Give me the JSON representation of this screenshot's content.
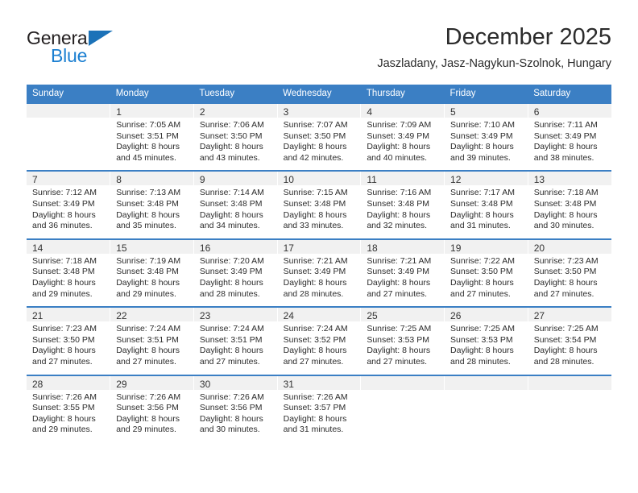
{
  "brand": {
    "name_top": "General",
    "name_bottom": "Blue",
    "triangle_color": "#1b72b8",
    "blue_color": "#1b7fd1"
  },
  "header": {
    "title": "December 2025",
    "subtitle": "Jaszladany, Jasz-Nagykun-Szolnok, Hungary"
  },
  "theme": {
    "header_bg": "#3b7fc4",
    "daynum_bg": "#f1f1f1",
    "text": "#2b2b2b"
  },
  "weekdays": [
    "Sunday",
    "Monday",
    "Tuesday",
    "Wednesday",
    "Thursday",
    "Friday",
    "Saturday"
  ],
  "weeks": [
    [
      {
        "day": "",
        "sunrise": "",
        "sunset": "",
        "daylight1": "",
        "daylight2": ""
      },
      {
        "day": "1",
        "sunrise": "Sunrise: 7:05 AM",
        "sunset": "Sunset: 3:51 PM",
        "daylight1": "Daylight: 8 hours",
        "daylight2": "and 45 minutes."
      },
      {
        "day": "2",
        "sunrise": "Sunrise: 7:06 AM",
        "sunset": "Sunset: 3:50 PM",
        "daylight1": "Daylight: 8 hours",
        "daylight2": "and 43 minutes."
      },
      {
        "day": "3",
        "sunrise": "Sunrise: 7:07 AM",
        "sunset": "Sunset: 3:50 PM",
        "daylight1": "Daylight: 8 hours",
        "daylight2": "and 42 minutes."
      },
      {
        "day": "4",
        "sunrise": "Sunrise: 7:09 AM",
        "sunset": "Sunset: 3:49 PM",
        "daylight1": "Daylight: 8 hours",
        "daylight2": "and 40 minutes."
      },
      {
        "day": "5",
        "sunrise": "Sunrise: 7:10 AM",
        "sunset": "Sunset: 3:49 PM",
        "daylight1": "Daylight: 8 hours",
        "daylight2": "and 39 minutes."
      },
      {
        "day": "6",
        "sunrise": "Sunrise: 7:11 AM",
        "sunset": "Sunset: 3:49 PM",
        "daylight1": "Daylight: 8 hours",
        "daylight2": "and 38 minutes."
      }
    ],
    [
      {
        "day": "7",
        "sunrise": "Sunrise: 7:12 AM",
        "sunset": "Sunset: 3:49 PM",
        "daylight1": "Daylight: 8 hours",
        "daylight2": "and 36 minutes."
      },
      {
        "day": "8",
        "sunrise": "Sunrise: 7:13 AM",
        "sunset": "Sunset: 3:48 PM",
        "daylight1": "Daylight: 8 hours",
        "daylight2": "and 35 minutes."
      },
      {
        "day": "9",
        "sunrise": "Sunrise: 7:14 AM",
        "sunset": "Sunset: 3:48 PM",
        "daylight1": "Daylight: 8 hours",
        "daylight2": "and 34 minutes."
      },
      {
        "day": "10",
        "sunrise": "Sunrise: 7:15 AM",
        "sunset": "Sunset: 3:48 PM",
        "daylight1": "Daylight: 8 hours",
        "daylight2": "and 33 minutes."
      },
      {
        "day": "11",
        "sunrise": "Sunrise: 7:16 AM",
        "sunset": "Sunset: 3:48 PM",
        "daylight1": "Daylight: 8 hours",
        "daylight2": "and 32 minutes."
      },
      {
        "day": "12",
        "sunrise": "Sunrise: 7:17 AM",
        "sunset": "Sunset: 3:48 PM",
        "daylight1": "Daylight: 8 hours",
        "daylight2": "and 31 minutes."
      },
      {
        "day": "13",
        "sunrise": "Sunrise: 7:18 AM",
        "sunset": "Sunset: 3:48 PM",
        "daylight1": "Daylight: 8 hours",
        "daylight2": "and 30 minutes."
      }
    ],
    [
      {
        "day": "14",
        "sunrise": "Sunrise: 7:18 AM",
        "sunset": "Sunset: 3:48 PM",
        "daylight1": "Daylight: 8 hours",
        "daylight2": "and 29 minutes."
      },
      {
        "day": "15",
        "sunrise": "Sunrise: 7:19 AM",
        "sunset": "Sunset: 3:48 PM",
        "daylight1": "Daylight: 8 hours",
        "daylight2": "and 29 minutes."
      },
      {
        "day": "16",
        "sunrise": "Sunrise: 7:20 AM",
        "sunset": "Sunset: 3:49 PM",
        "daylight1": "Daylight: 8 hours",
        "daylight2": "and 28 minutes."
      },
      {
        "day": "17",
        "sunrise": "Sunrise: 7:21 AM",
        "sunset": "Sunset: 3:49 PM",
        "daylight1": "Daylight: 8 hours",
        "daylight2": "and 28 minutes."
      },
      {
        "day": "18",
        "sunrise": "Sunrise: 7:21 AM",
        "sunset": "Sunset: 3:49 PM",
        "daylight1": "Daylight: 8 hours",
        "daylight2": "and 27 minutes."
      },
      {
        "day": "19",
        "sunrise": "Sunrise: 7:22 AM",
        "sunset": "Sunset: 3:50 PM",
        "daylight1": "Daylight: 8 hours",
        "daylight2": "and 27 minutes."
      },
      {
        "day": "20",
        "sunrise": "Sunrise: 7:23 AM",
        "sunset": "Sunset: 3:50 PM",
        "daylight1": "Daylight: 8 hours",
        "daylight2": "and 27 minutes."
      }
    ],
    [
      {
        "day": "21",
        "sunrise": "Sunrise: 7:23 AM",
        "sunset": "Sunset: 3:50 PM",
        "daylight1": "Daylight: 8 hours",
        "daylight2": "and 27 minutes."
      },
      {
        "day": "22",
        "sunrise": "Sunrise: 7:24 AM",
        "sunset": "Sunset: 3:51 PM",
        "daylight1": "Daylight: 8 hours",
        "daylight2": "and 27 minutes."
      },
      {
        "day": "23",
        "sunrise": "Sunrise: 7:24 AM",
        "sunset": "Sunset: 3:51 PM",
        "daylight1": "Daylight: 8 hours",
        "daylight2": "and 27 minutes."
      },
      {
        "day": "24",
        "sunrise": "Sunrise: 7:24 AM",
        "sunset": "Sunset: 3:52 PM",
        "daylight1": "Daylight: 8 hours",
        "daylight2": "and 27 minutes."
      },
      {
        "day": "25",
        "sunrise": "Sunrise: 7:25 AM",
        "sunset": "Sunset: 3:53 PM",
        "daylight1": "Daylight: 8 hours",
        "daylight2": "and 27 minutes."
      },
      {
        "day": "26",
        "sunrise": "Sunrise: 7:25 AM",
        "sunset": "Sunset: 3:53 PM",
        "daylight1": "Daylight: 8 hours",
        "daylight2": "and 28 minutes."
      },
      {
        "day": "27",
        "sunrise": "Sunrise: 7:25 AM",
        "sunset": "Sunset: 3:54 PM",
        "daylight1": "Daylight: 8 hours",
        "daylight2": "and 28 minutes."
      }
    ],
    [
      {
        "day": "28",
        "sunrise": "Sunrise: 7:26 AM",
        "sunset": "Sunset: 3:55 PM",
        "daylight1": "Daylight: 8 hours",
        "daylight2": "and 29 minutes."
      },
      {
        "day": "29",
        "sunrise": "Sunrise: 7:26 AM",
        "sunset": "Sunset: 3:56 PM",
        "daylight1": "Daylight: 8 hours",
        "daylight2": "and 29 minutes."
      },
      {
        "day": "30",
        "sunrise": "Sunrise: 7:26 AM",
        "sunset": "Sunset: 3:56 PM",
        "daylight1": "Daylight: 8 hours",
        "daylight2": "and 30 minutes."
      },
      {
        "day": "31",
        "sunrise": "Sunrise: 7:26 AM",
        "sunset": "Sunset: 3:57 PM",
        "daylight1": "Daylight: 8 hours",
        "daylight2": "and 31 minutes."
      },
      {
        "day": "",
        "sunrise": "",
        "sunset": "",
        "daylight1": "",
        "daylight2": ""
      },
      {
        "day": "",
        "sunrise": "",
        "sunset": "",
        "daylight1": "",
        "daylight2": ""
      },
      {
        "day": "",
        "sunrise": "",
        "sunset": "",
        "daylight1": "",
        "daylight2": ""
      }
    ]
  ]
}
